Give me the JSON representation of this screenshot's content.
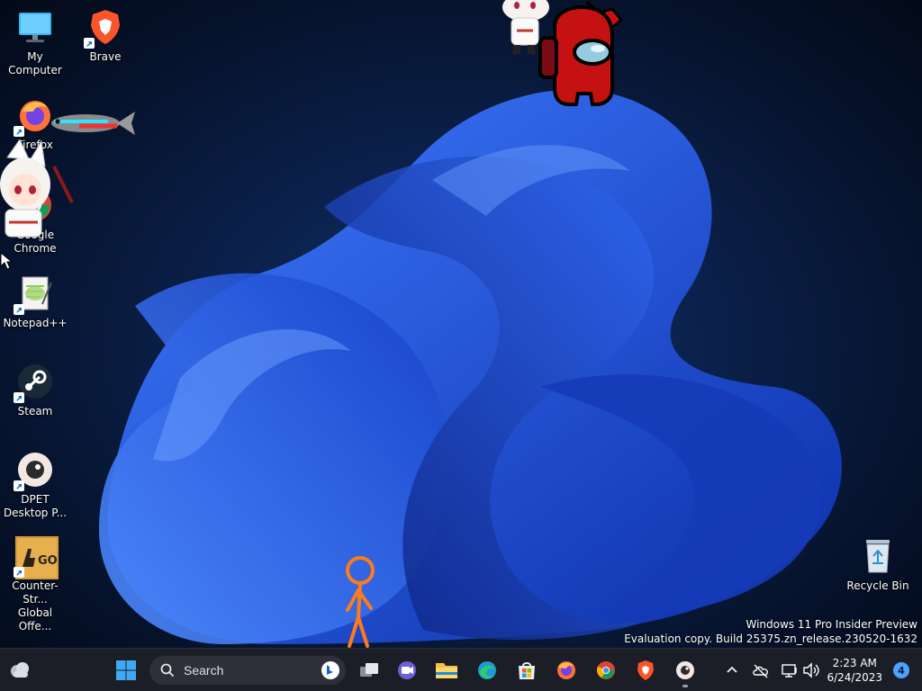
{
  "desktop": {
    "icons": [
      {
        "label": "My Computer"
      },
      {
        "label": "Brave"
      },
      {
        "label": "Firefox"
      },
      {
        "label": "Google\nChrome"
      },
      {
        "label": "Notepad++"
      },
      {
        "label": "Steam"
      },
      {
        "label": "DPET\nDesktop P..."
      },
      {
        "label": "Counter-Str...\nGlobal Offe..."
      },
      {
        "label": "Recycle Bin"
      }
    ],
    "watermark": {
      "line1": "Windows 11 Pro Insider Preview",
      "line2": "Evaluation copy. Build 25375.zn_release.230520-1632"
    }
  },
  "taskbar": {
    "search": {
      "placeholder": "Search"
    },
    "clock": {
      "time": "2:23 AM",
      "date": "6/24/2023"
    },
    "notification_count": "4"
  },
  "colors": {
    "taskbar_bg": "#1b1e26",
    "wallpaper_blue": "#1f55e0",
    "accent": "#4aa3ff"
  }
}
